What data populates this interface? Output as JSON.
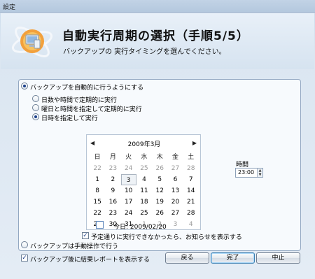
{
  "window": {
    "title": "設定"
  },
  "header": {
    "title": "自動実行周期の選択（手順5/5）",
    "subtitle": "バックアップの 実行タイミングを選んでください。"
  },
  "options": {
    "auto": "バックアップを自動的に行うようにする",
    "sub": [
      {
        "label": "日数や時間で定期的に実行",
        "checked": false
      },
      {
        "label": "曜日と時間を指定して定期的に実行",
        "checked": false
      },
      {
        "label": "日時を指定して実行",
        "checked": true
      }
    ],
    "manual": "バックアップは手動操作で行う"
  },
  "calendar": {
    "month": "2009年3月",
    "prev": "◀",
    "next": "▶",
    "weekdays": [
      "日",
      "月",
      "火",
      "水",
      "木",
      "金",
      "土"
    ],
    "weeks": [
      [
        "22",
        "23",
        "24",
        "25",
        "26",
        "27",
        "28"
      ],
      [
        "1",
        "2",
        "3",
        "4",
        "5",
        "6",
        "7"
      ],
      [
        "8",
        "9",
        "10",
        "11",
        "12",
        "13",
        "14"
      ],
      [
        "15",
        "16",
        "17",
        "18",
        "19",
        "20",
        "21"
      ],
      [
        "22",
        "23",
        "24",
        "25",
        "26",
        "27",
        "28"
      ],
      [
        "29",
        "30",
        "31",
        "1",
        "2",
        "3",
        "4"
      ]
    ],
    "selected": "3",
    "today_label": "今日: 2009/02/20"
  },
  "time": {
    "label": "時間",
    "value": "23:00"
  },
  "notify_check": {
    "label": "予定通りに実行できなかったら、お知らせを表示する",
    "checked": true
  },
  "report_check": {
    "label": "バックアップ後に結果レポートを表示する",
    "checked": true
  },
  "buttons": {
    "back": "戻る",
    "finish": "完了",
    "cancel": "中止"
  }
}
